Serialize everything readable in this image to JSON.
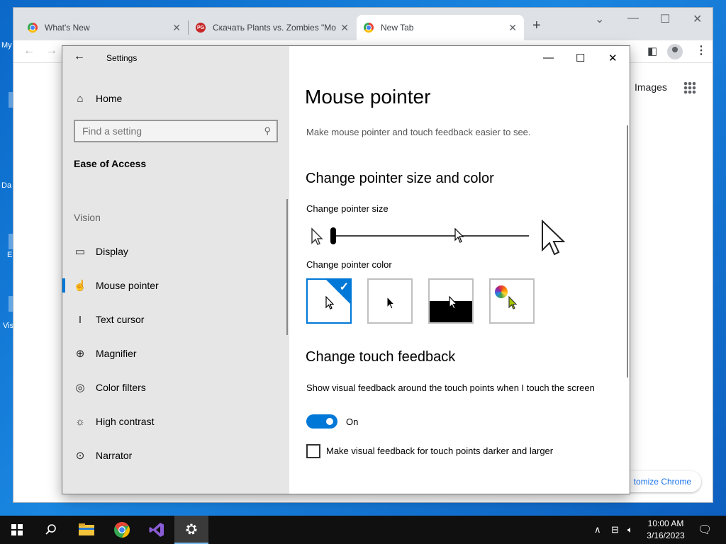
{
  "desktop": {
    "icon_labels": [
      "My",
      "Da",
      "E",
      "Vis"
    ]
  },
  "browser": {
    "tabs": [
      {
        "title": "What's New",
        "favicon": "chrome-icon"
      },
      {
        "title": "Скачать Plants vs. Zombies \"Mo",
        "favicon": "pg-icon"
      },
      {
        "title": "New Tab",
        "favicon": "chrome-icon"
      }
    ],
    "pg_favicon_text": "PG",
    "new_tab_symbol": "+",
    "close_symbol": "✕",
    "images_link": "Images",
    "customize_label": "tomize Chrome"
  },
  "settings": {
    "app_title": "Settings",
    "home_label": "Home",
    "search_placeholder": "Find a setting",
    "section_heading": "Ease of Access",
    "group_label": "Vision",
    "nav": [
      {
        "label": "Display",
        "icon": "display-icon"
      },
      {
        "label": "Mouse pointer",
        "icon": "mouse-pointer-icon",
        "selected": true
      },
      {
        "label": "Text cursor",
        "icon": "text-cursor-icon"
      },
      {
        "label": "Magnifier",
        "icon": "magnifier-icon"
      },
      {
        "label": "Color filters",
        "icon": "color-filters-icon"
      },
      {
        "label": "High contrast",
        "icon": "high-contrast-icon"
      },
      {
        "label": "Narrator",
        "icon": "narrator-icon"
      }
    ],
    "page_title": "Mouse pointer",
    "page_description": "Make mouse pointer and touch feedback easier to see.",
    "size_section": {
      "heading": "Change pointer size and color",
      "size_label": "Change pointer size",
      "size_value": 1,
      "color_label": "Change pointer color",
      "color_options": [
        "white",
        "black",
        "inverted",
        "custom"
      ],
      "selected_color": "white"
    },
    "touch_section": {
      "heading": "Change touch feedback",
      "feedback_label": "Show visual feedback around the touch points when I touch the screen",
      "toggle_state": "On",
      "checkbox_label": "Make visual feedback for touch points darker and larger",
      "checkbox_checked": false
    },
    "accent_color": "#0078d7"
  },
  "taskbar": {
    "time": "10:00 AM",
    "date": "3/16/2023",
    "apps": [
      "start",
      "search",
      "file-explorer",
      "chrome",
      "visual-studio",
      "settings"
    ]
  }
}
